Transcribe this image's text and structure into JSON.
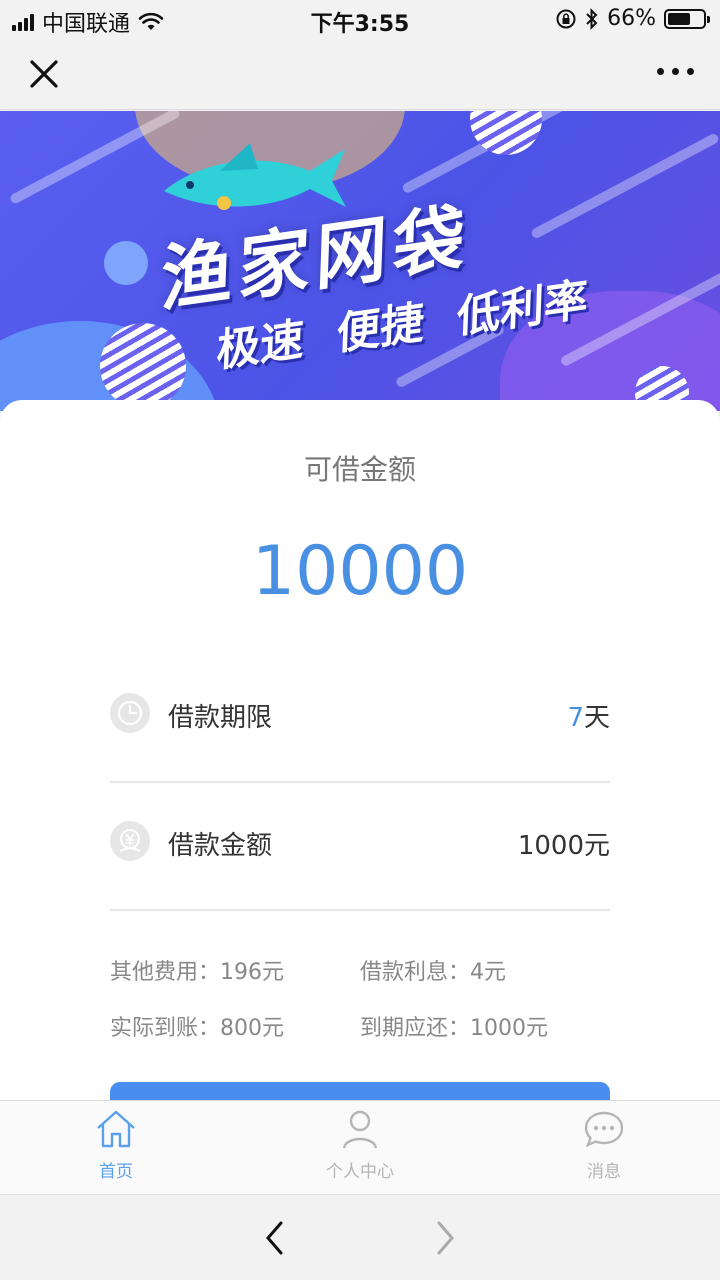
{
  "status_bar": {
    "carrier": "中国联通",
    "time": "下午3:55",
    "battery_percent": "66%",
    "battery_level": 0.66
  },
  "banner": {
    "title": "渔家网袋",
    "subtitle": "极速 便捷 低利率"
  },
  "loan": {
    "available_label": "可借金额",
    "available_amount": "10000",
    "term": {
      "label": "借款期限",
      "value_num": "7",
      "value_unit": "天"
    },
    "amount": {
      "label": "借款金额",
      "value": "1000元"
    },
    "fees": {
      "other_fee": "其他费用：196元",
      "interest": "借款利息：4元",
      "actual_received": "实际到账：800元",
      "due_repay": "到期应还：1000元"
    }
  },
  "tabbar": {
    "tabs": [
      {
        "label": "首页",
        "icon": "home-icon",
        "active": true
      },
      {
        "label": "个人中心",
        "icon": "user-icon",
        "active": false
      },
      {
        "label": "消息",
        "icon": "message-icon",
        "active": false
      }
    ]
  },
  "colors": {
    "accent": "#4a90e2",
    "banner": "#5057e8",
    "button": "#4a8df0"
  }
}
